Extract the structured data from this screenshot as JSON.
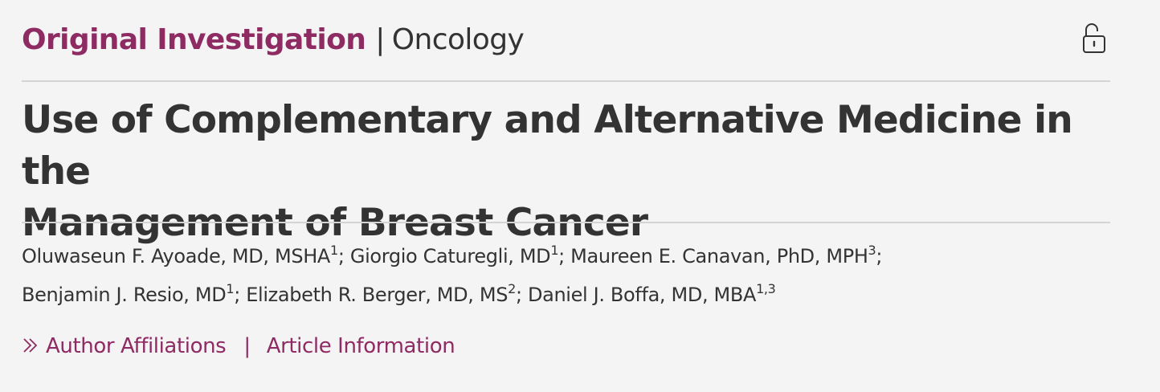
{
  "header": {
    "category_primary": "Original Investigation",
    "separator": "|",
    "category_secondary": "Oncology",
    "access_icon": "unlocked-padlock-icon"
  },
  "title": {
    "line1": "Use of Complementary and Alternative Medicine in the",
    "line2": "Management of Breast Cancer"
  },
  "authors": [
    {
      "name": "Oluwaseun F. Ayoade, MD, MSHA",
      "aff": "1",
      "sep": "; "
    },
    {
      "name": "Giorgio Caturegli, MD",
      "aff": "1",
      "sep": "; "
    },
    {
      "name": "Maureen E. Canavan, PhD, MPH",
      "aff": "3",
      "sep": ";"
    },
    {
      "name": "Benjamin J. Resio, MD",
      "aff": "1",
      "sep": "; "
    },
    {
      "name": "Elizabeth R. Berger, MD, MS",
      "aff": "2",
      "sep": "; "
    },
    {
      "name": "Daniel J. Boffa, MD, MBA",
      "aff": "1,3",
      "sep": ""
    }
  ],
  "links": {
    "chevron_icon": "double-chevron-right-icon",
    "author_affiliations": "Author Affiliations",
    "separator": "|",
    "article_information": "Article Information"
  },
  "colors": {
    "accent": "#8e2b63",
    "text": "#333333",
    "background": "#f4f4f4",
    "rule": "#d4d4d4"
  }
}
